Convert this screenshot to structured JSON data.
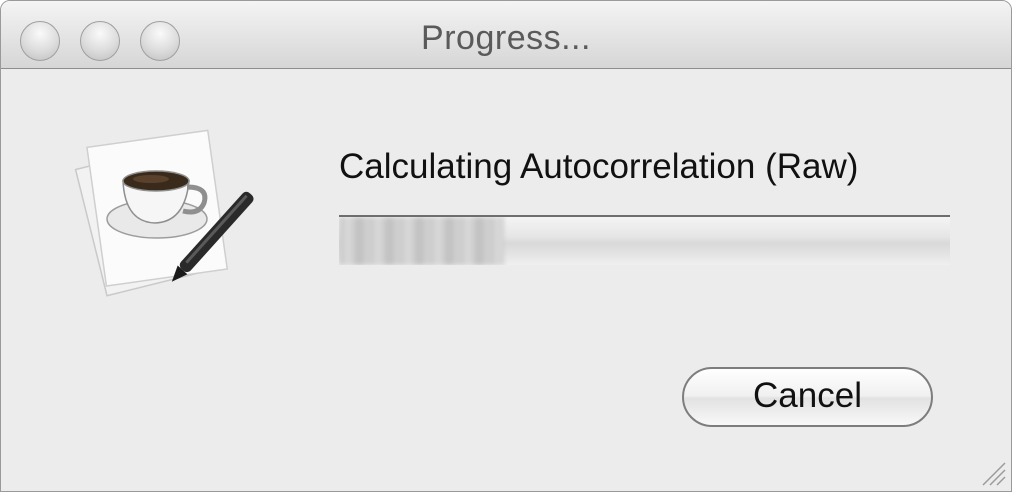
{
  "window": {
    "title": "Progress...",
    "controls": [
      "close",
      "minimize",
      "zoom"
    ]
  },
  "app_icon": {
    "name": "java-coffee-document-pen-icon"
  },
  "progress": {
    "message": "Calculating Autocorrelation (Raw)",
    "fraction": 0.27,
    "indeterminate": false
  },
  "buttons": {
    "cancel_label": "Cancel"
  },
  "colors": {
    "window_background": "#ececec",
    "titlebar_top": "#f4f4f4",
    "titlebar_bottom": "#d6d6d6",
    "text": "#111111",
    "title_text": "#5a5a5a"
  }
}
